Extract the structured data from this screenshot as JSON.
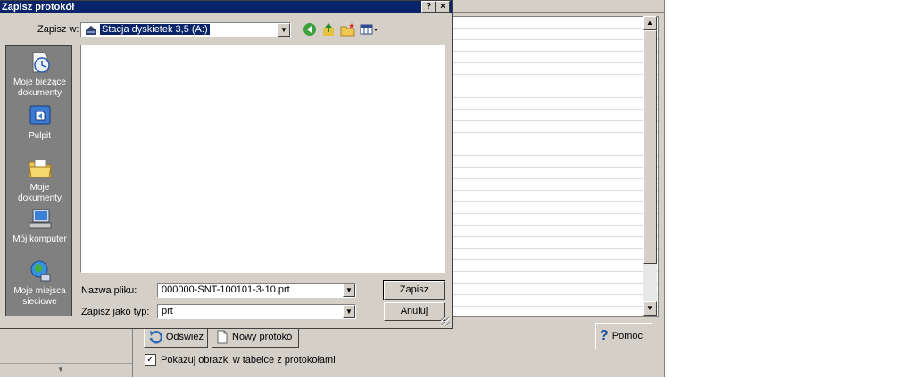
{
  "dialog": {
    "title": "Zapisz protokół",
    "help_btn": "?",
    "close_btn": "×",
    "look_in_label": "Zapisz w:",
    "look_in_value": "Stacja dyskietek 3,5 (A:)",
    "filename_label": "Nazwa pliku:",
    "filename_value": "000000-SNT-100101-3-10.prt",
    "filetype_label": "Zapisz jako typ:",
    "filetype_value": "prt",
    "save_button": "Zapisz",
    "cancel_button": "Anuluj",
    "toolbar_icons": [
      "back-icon",
      "up-folder-icon",
      "new-folder-icon",
      "views-menu-icon"
    ],
    "places": [
      {
        "label_1": "Moje bieżące",
        "label_2": "dokumenty",
        "icon": "recent-documents-icon"
      },
      {
        "label_1": "Pulpit",
        "label_2": "",
        "icon": "desktop-icon"
      },
      {
        "label_1": "Moje",
        "label_2": "dokumenty",
        "icon": "my-documents-icon"
      },
      {
        "label_1": "Mój komputer",
        "label_2": "",
        "icon": "my-computer-icon"
      },
      {
        "label_1": "Moje miejsca",
        "label_2": "sieciowe",
        "icon": "network-places-icon"
      }
    ]
  },
  "background": {
    "refresh_button": "Odśwież",
    "new_protocol_button": "Nowy protokó",
    "help_button": "Pomoc",
    "show_images_checkbox": "Pokazuj obrazki w tabelce z protokołami",
    "show_images_checked": true
  },
  "colors": {
    "titlebar": "#0a246a",
    "face": "#d4d0c8",
    "places_bar": "#808080"
  }
}
